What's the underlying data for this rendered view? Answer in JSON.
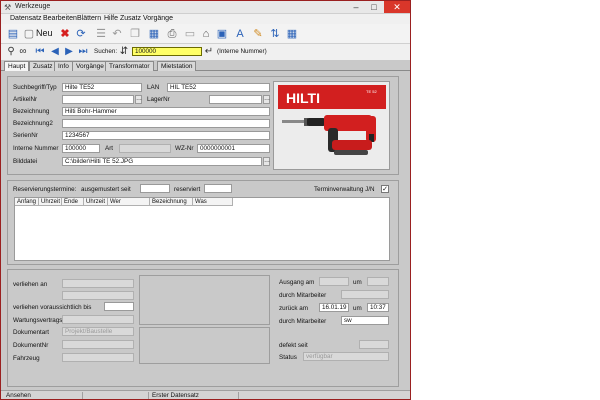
{
  "window": {
    "title": "Werkzeuge",
    "app_icon": "tool-icon"
  },
  "menu": [
    "Datensatz",
    "Bearbeiten",
    "Blättern",
    "Hilfe",
    "Zusatz",
    "Vorgänge"
  ],
  "toolbar": {
    "new_label": "Neu"
  },
  "search": {
    "label": "Suchen:",
    "value": "100000",
    "hint": "(Interne Nummer)"
  },
  "tabs": [
    "Haupt",
    "Zusatz",
    "Info",
    "Vorgänge",
    "Transformator",
    "Mietstation"
  ],
  "form": {
    "suchbegriff_label": "Suchbegriff/Typ",
    "suchbegriff": "Hilte TE52",
    "lan_label": "LAN",
    "lan": "HIL TE52",
    "artikelnr_label": "ArtikelNr",
    "artikelnr": "",
    "lagernr_label": "LagerNr",
    "lagernr": "",
    "bezeichnung_label": "Bezeichnung",
    "bezeichnung": "Hilti Bohr-Hammer",
    "bezeichnung2_label": "Bezeichnung2",
    "bezeichnung2": "",
    "seriennr_label": "SerienNr",
    "seriennr": "1234567",
    "interne_label": "Interne Nummer",
    "interne": "100000",
    "art_label": "Art",
    "art": "",
    "wznr_label": "WZ-Nr",
    "wznr": "0000000001",
    "bilddatei_label": "Bilddatei",
    "bilddatei": "C:\\bilder\\Hilti TE 52.JPG"
  },
  "photo": {
    "brand": "HILTI",
    "model": "TE 52"
  },
  "reservation": {
    "label": "Reservierungstermine:",
    "ausgemustert_label": "ausgemustert seit",
    "ausgemustert": "",
    "reserviert_label": "reserviert",
    "reserviert": "",
    "termin_label": "Terminverwaltung J/N",
    "termin_checked": "✓",
    "columns": [
      "Anfang",
      "Uhrzeit",
      "Ende",
      "Uhrzeit",
      "Wer",
      "Bezeichnung",
      "Was"
    ]
  },
  "lending": {
    "verliehen_an_label": "verliehen an",
    "verliehen_bis_label": "verliehen voraussichtlich bis",
    "wartung_label": "WartungsvertragsNr",
    "dokumentart_label": "Dokumentart",
    "dokumentart": "Projekt/Baustelle",
    "dokumentnr_label": "DokumentNr",
    "fahrzeug_label": "Fahrzeug"
  },
  "return": {
    "ausgang_label": "Ausgang am",
    "um1_label": "um",
    "mitarbeiter1_label": "durch Mitarbeiter",
    "zurueck_label": "zurück am",
    "zurueck": "16.01.19",
    "um2_label": "um",
    "zurueck_time": "10:37",
    "mitarbeiter2_label": "durch Mitarbeiter",
    "mitarbeiter2": "sw",
    "defekt_label": "defekt seit",
    "status_label": "Status",
    "status": "verfügbar"
  },
  "statusbar": [
    "Ansehen",
    "",
    "Erster Datensatz"
  ]
}
